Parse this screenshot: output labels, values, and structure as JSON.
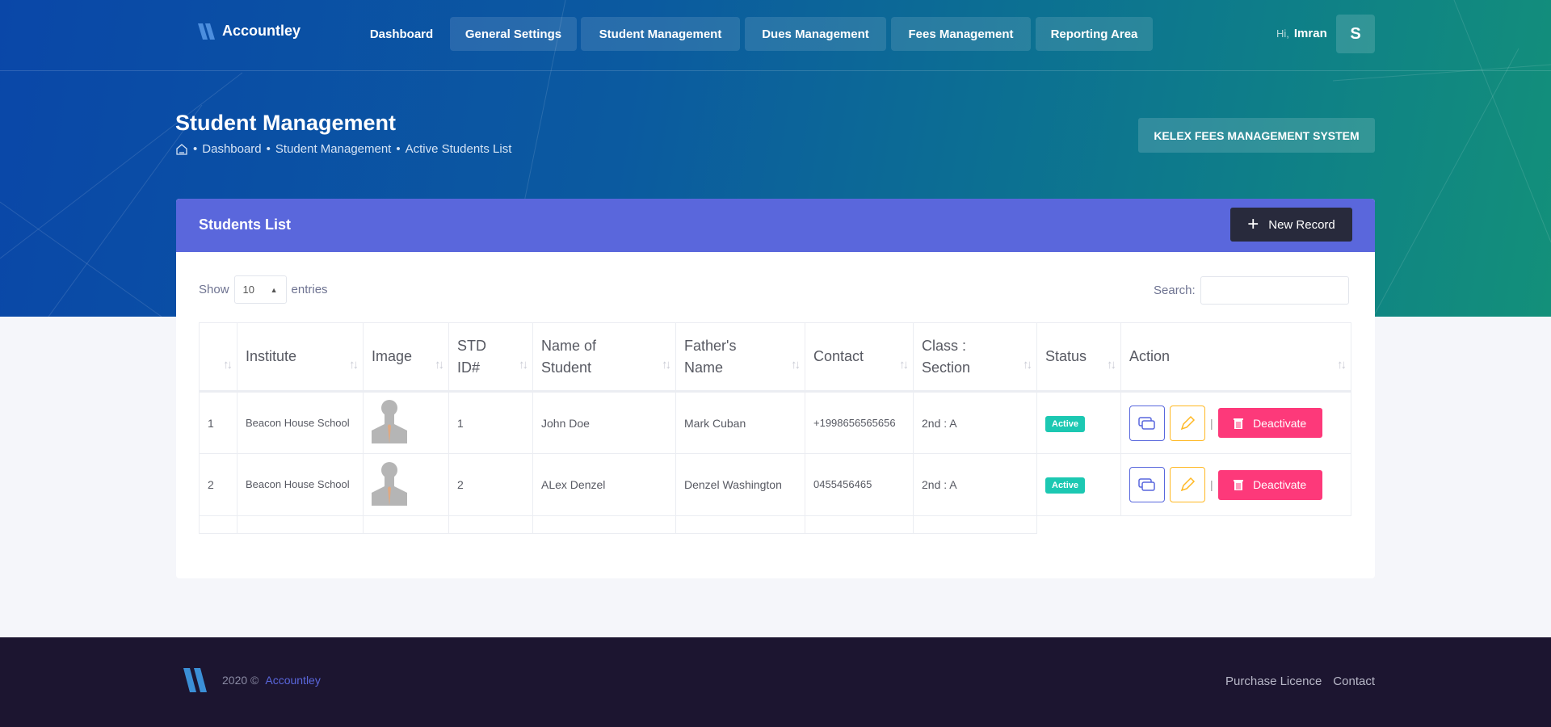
{
  "brand": "Accountley",
  "nav": [
    {
      "label": "Dashboard"
    },
    {
      "label": "General Settings"
    },
    {
      "label": "Student Management"
    },
    {
      "label": "Dues Management"
    },
    {
      "label": "Fees Management"
    },
    {
      "label": "Reporting Area"
    }
  ],
  "user": {
    "greeting": "Hi,",
    "name": "Imran",
    "initial": "S"
  },
  "page": {
    "title": "Student Management",
    "breadcrumb": [
      "Dashboard",
      "Student Management",
      "Active Students List"
    ],
    "system_button": "KELEX FEES MANAGEMENT SYSTEM"
  },
  "card": {
    "title": "Students List",
    "new_record": "New Record",
    "show": "Show",
    "entries_value": "10",
    "entries": "entries",
    "search_label": "Search:",
    "search_value": ""
  },
  "table": {
    "headers": [
      "",
      "Institute",
      "Image",
      "STD ID#",
      "Name of Student",
      "Father's Name",
      "Contact",
      "Class : Section",
      "Status",
      "Action"
    ],
    "rows": [
      {
        "no": "1",
        "institute": "Beacon House School",
        "std_id": "1",
        "name": "John Doe",
        "father": "Mark Cuban",
        "contact": "+1998656565656",
        "class": "2nd : A",
        "status": "Active",
        "deactivate": "Deactivate"
      },
      {
        "no": "2",
        "institute": "Beacon House School",
        "std_id": "2",
        "name": "ALex Denzel",
        "father": "Denzel Washington",
        "contact": "0455456465",
        "class": "2nd : A",
        "status": "Active",
        "deactivate": "Deactivate"
      }
    ]
  },
  "footer": {
    "year": "2020 ©",
    "brand": "Accountley",
    "links": [
      "Purchase Licence",
      "Contact"
    ]
  }
}
